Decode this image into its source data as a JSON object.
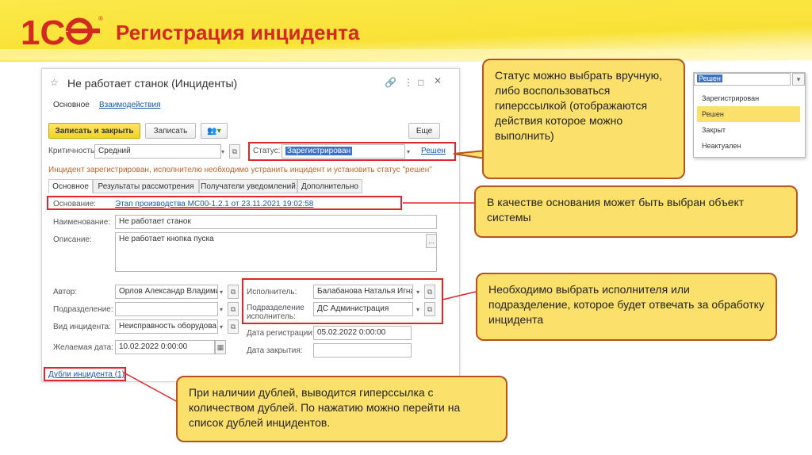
{
  "slide": {
    "title": "Регистрация инцидента",
    "logo_text": "1С",
    "logo_mark": "®"
  },
  "window": {
    "title": "Не работает станок (Инциденты)",
    "tabs_top": [
      "Основное",
      "Взаимодействия"
    ],
    "toolbar": {
      "save_close": "Записать и закрыть",
      "save": "Записать",
      "more": "Еще"
    },
    "criticality_label": "Критичность:",
    "criticality_value": "Средний",
    "status_label": "Статус:",
    "status_value": "Зарегистрирован",
    "status_link": "Решен",
    "hint": "Инцидент зарегистрирован, исполнителю необходимо устранить инцидент и установить статус \"решен\"",
    "tabs": [
      "Основное",
      "Результаты рассмотрения",
      "Получатели уведомлений",
      "Дополнительно"
    ],
    "basis_label": "Основание:",
    "basis_link": "Этап производства МС00-1.2.1 от 23.11.2021 19:02:58",
    "name_label": "Наименование:",
    "name_value": "Не работает станок",
    "desc_label": "Описание:",
    "desc_value": "Не работает кнопка пуска",
    "desc_more": "...",
    "author_label": "Автор:",
    "author_value": "Орлов Александр Владими",
    "dept_label": "Подразделение:",
    "dept_value": "",
    "type_label": "Вид инцидента:",
    "type_value": "Неисправность оборудова",
    "wish_label": "Желаемая дата:",
    "wish_value": "10.02.2022  0:00:00",
    "exec_label": "Исполнитель:",
    "exec_value": "Балабанова Наталья Игна",
    "exec_dept_label": "Подразделение исполнитель:",
    "exec_dept_value": "ДС Администрация",
    "reg_label": "Дата регистрации:",
    "reg_value": "05.02.2022  0:00:00",
    "close_label": "Дата закрытия:",
    "close_value": "",
    "dup_link": "Дубли инцидента (1)"
  },
  "dropdown": {
    "value": "Решен",
    "options": [
      "Зарегистрирован",
      "Решен",
      "Закрыт",
      "Неактуален"
    ],
    "selected_index": 1
  },
  "callouts": {
    "status": "Статус можно выбрать вручную, либо воспользоваться гиперссылкой (отображаются действия которое можно выполнить)",
    "basis": "В качестве основания может быть выбран объект системы",
    "executor": "Необходимо выбрать исполнителя или подразделение, которое будет отвечать за обработку инцидента",
    "duplicates": "При наличии дублей, выводится гиперссылка с количеством дублей. По нажатию можно перейти на список дублей инцидентов."
  },
  "colors": {
    "accent_red": "#e0262a",
    "callout_fill": "#fbe16c",
    "callout_border": "#b5541f",
    "link": "#1a5aa8",
    "title_red": "#d32a1f"
  }
}
